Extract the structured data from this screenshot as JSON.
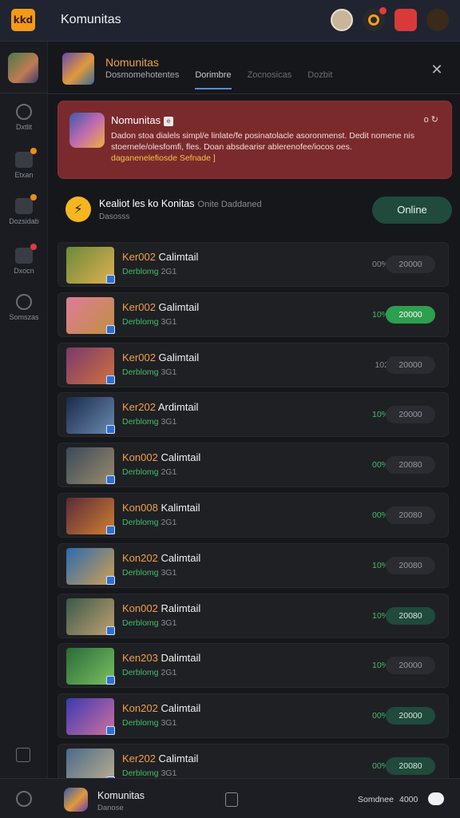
{
  "app": {
    "title": "Komunitas",
    "logo_text": "kkd"
  },
  "top_icons": [
    {
      "name": "profile-avatar-icon",
      "color": "#c9b69a"
    },
    {
      "name": "notification-icon",
      "color": "#f0a020"
    },
    {
      "name": "shop-icon",
      "color": "#d83a3a"
    },
    {
      "name": "user-menu-icon",
      "color": "#3a2a1a"
    }
  ],
  "sidebar": {
    "items": [
      {
        "label": "Dxtlit",
        "icon": "discover-icon",
        "dot": false
      },
      {
        "label": "Etxan",
        "icon": "chat-icon",
        "dot": "orange"
      },
      {
        "label": "Dozsidab",
        "icon": "games-icon",
        "dot": "orange"
      },
      {
        "label": "Dxocn",
        "icon": "video-icon",
        "dot": "red"
      },
      {
        "label": "Somszas",
        "icon": "settings-icon",
        "dot": false
      }
    ]
  },
  "community": {
    "name": "Nomunitas",
    "tabs": [
      "Dosmomehotentes",
      "Dorimbre",
      "Zocnosicas",
      "Dozbit"
    ],
    "active_tab": 1
  },
  "announcement": {
    "title": "Nomunitas",
    "tag": "e",
    "more": "o ↻",
    "body": "Dadon stoa dialels simpl/e linlate/fe posinatolacle asoronmenst. Dedit nomene nis stoernele/olesfomfi, fles. Doan absdearisr ablerenofee/iocos oes.",
    "link": "daganenelefiosde Sefnade ]"
  },
  "status": {
    "title": "Kealiot les ko Konitas",
    "title_suffix": "Onite  Daddaned",
    "subtitle": "Dasosss",
    "button": "Online"
  },
  "channels": [
    {
      "prefix": "Ker002",
      "name": " Calimtail",
      "sub_a": "Derblomg",
      "sub_b": " 2G1",
      "pct": "00%",
      "pct_green": false,
      "pill": "20000",
      "pill_style": "off"
    },
    {
      "prefix": "Ker002",
      "name": " Galimtail",
      "sub_a": "Derblomg",
      "sub_b": " 3G1",
      "pct": "10%",
      "pct_green": true,
      "pill": "20000",
      "pill_style": "on"
    },
    {
      "prefix": "Ker002",
      "name": " Galimtail",
      "sub_a": "Derblomg",
      "sub_b": " 3G1",
      "pct": "102",
      "pct_green": false,
      "pill": "20000",
      "pill_style": "off"
    },
    {
      "prefix": "Ker202",
      "name": " Ardimtail",
      "sub_a": "Derblomg",
      "sub_b": " 3G1",
      "pct": "10%",
      "pct_green": true,
      "pill": "20000",
      "pill_style": "off"
    },
    {
      "prefix": "Kon002",
      "name": " Calimtail",
      "sub_a": "Derblomg",
      "sub_b": " 2G1",
      "pct": "00%",
      "pct_green": true,
      "pill": "20080",
      "pill_style": "off"
    },
    {
      "prefix": "Kon008",
      "name": " Kalimtail",
      "sub_a": "Derblomg",
      "sub_b": " 2G1",
      "pct": "00%",
      "pct_green": true,
      "pill": "20080",
      "pill_style": "off"
    },
    {
      "prefix": "Kon202",
      "name": " Calimtail",
      "sub_a": "Derblomg",
      "sub_b": " 3G1",
      "pct": "10%",
      "pct_green": true,
      "pill": "20080",
      "pill_style": "off"
    },
    {
      "prefix": "Kon002",
      "name": " Ralimtail",
      "sub_a": "Derblomg",
      "sub_b": " 3G1",
      "pct": "10%",
      "pct_green": true,
      "pill": "20080",
      "pill_style": "soft"
    },
    {
      "prefix": "Ken203",
      "name": " Dalimtail",
      "sub_a": "Derblomg",
      "sub_b": " 2G1",
      "pct": "10%",
      "pct_green": true,
      "pill": "20000",
      "pill_style": "off"
    },
    {
      "prefix": "Kon202",
      "name": " Calimtail",
      "sub_a": "Derblomg",
      "sub_b": " 3G1",
      "pct": "00%",
      "pct_green": true,
      "pill": "20000",
      "pill_style": "soft"
    },
    {
      "prefix": "Ker202",
      "name": " Calimtail",
      "sub_a": "Derblomg",
      "sub_b": " 3G1",
      "pct": "00%",
      "pct_green": true,
      "pill": "20080",
      "pill_style": "soft"
    }
  ],
  "bottom": {
    "name": "Komunitas",
    "sub": "Danose",
    "right_text": "Somdnee",
    "count": "4000"
  }
}
